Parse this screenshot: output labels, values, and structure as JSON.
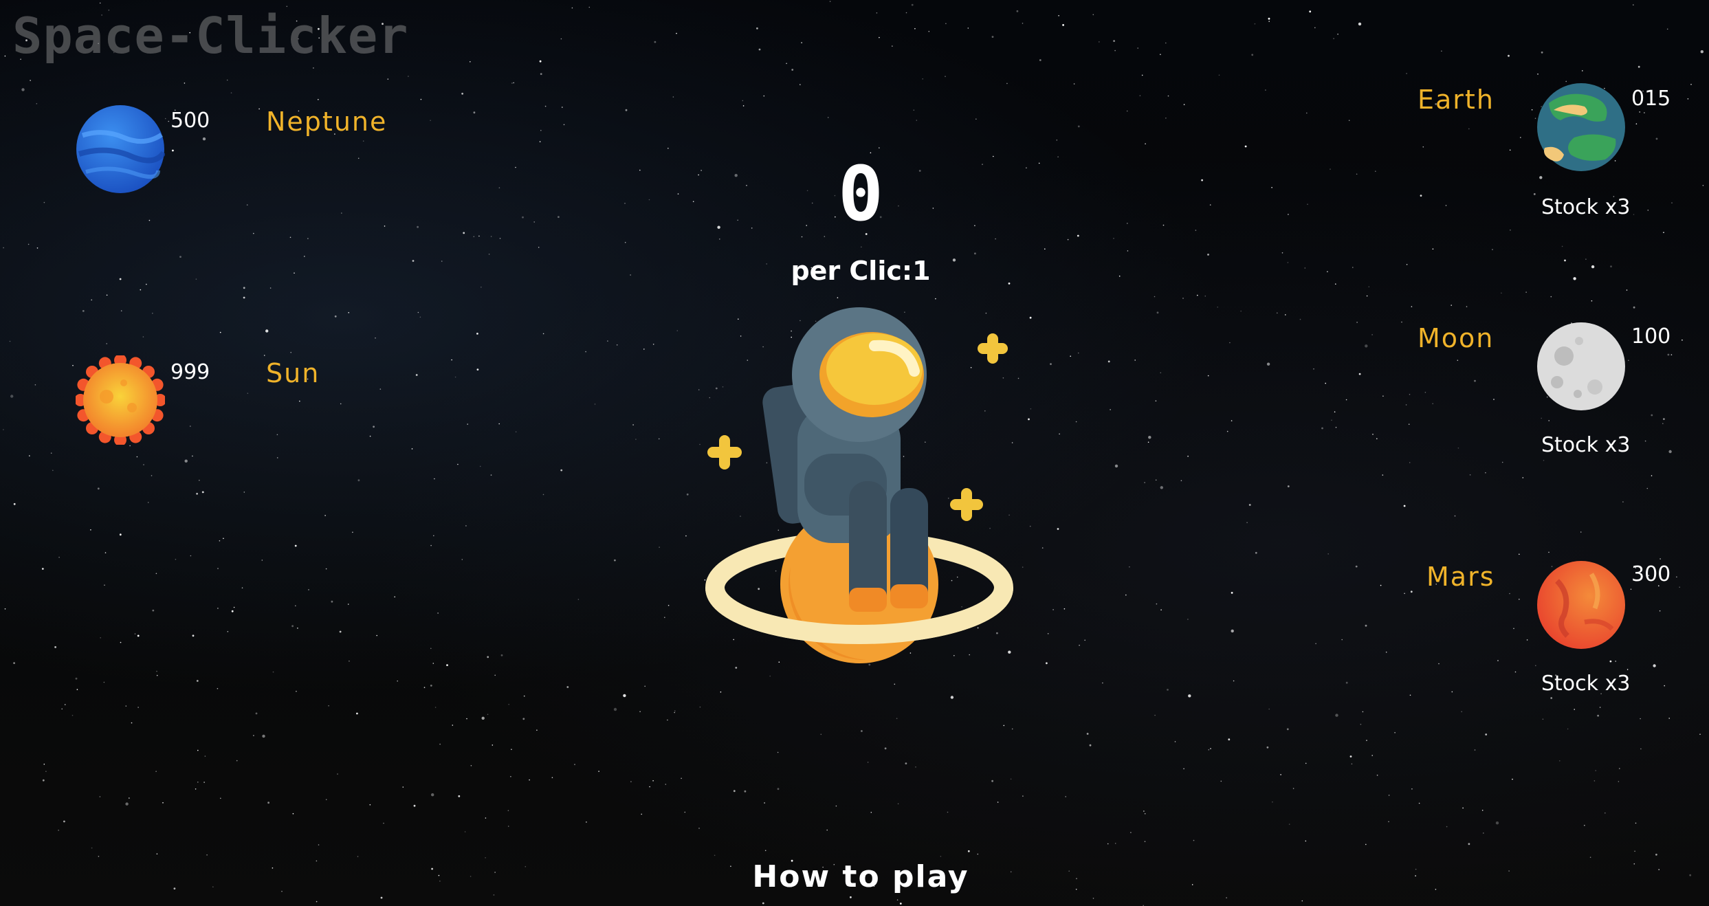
{
  "app": {
    "title": "Space-Clicker"
  },
  "counter": {
    "score": "0",
    "per_click_label": "per Clic:1"
  },
  "shop_left": [
    {
      "name": "Neptune",
      "price": "500",
      "icon": "neptune-icon"
    },
    {
      "name": "Sun",
      "price": "999",
      "icon": "sun-icon"
    }
  ],
  "shop_right": [
    {
      "name": "Earth",
      "price": "015",
      "stock": "Stock x3",
      "icon": "earth-icon"
    },
    {
      "name": "Moon",
      "price": "100",
      "stock": "Stock x3",
      "icon": "moon-icon"
    },
    {
      "name": "Mars",
      "price": "300",
      "stock": "Stock x3",
      "icon": "mars-icon"
    }
  ],
  "footer": {
    "how_to_play": "How to play"
  },
  "colors": {
    "planet_name": "#f0b32a",
    "text": "#ffffff",
    "title": "#8a8a8a",
    "background": "#000000"
  }
}
